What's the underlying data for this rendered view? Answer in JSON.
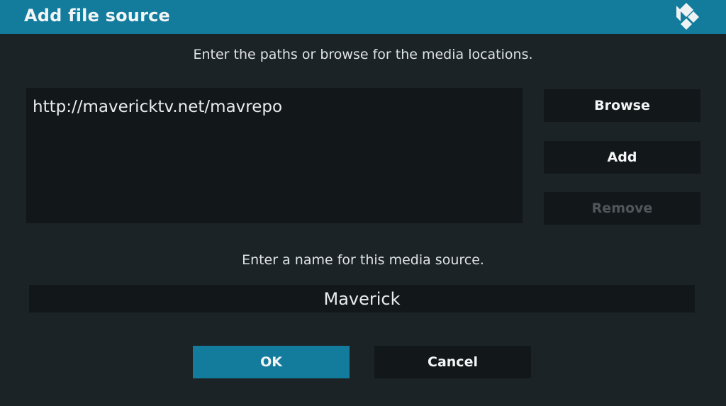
{
  "dialog": {
    "title": "Add file source",
    "logo_icon": "kodi-logo-icon"
  },
  "paths_section": {
    "prompt": "Enter the paths or browse for the media locations.",
    "items": [
      "http://mavericktv.net/mavrepo"
    ]
  },
  "side_buttons": {
    "browse_label": "Browse",
    "add_label": "Add",
    "remove_label": "Remove"
  },
  "name_section": {
    "prompt": "Enter a name for this media source.",
    "value": "Maverick"
  },
  "footer": {
    "ok_label": "OK",
    "cancel_label": "Cancel"
  },
  "colors": {
    "accent": "#137c9d",
    "background": "#1c2326",
    "panel": "#121719",
    "disabled_text": "#4f575b"
  }
}
